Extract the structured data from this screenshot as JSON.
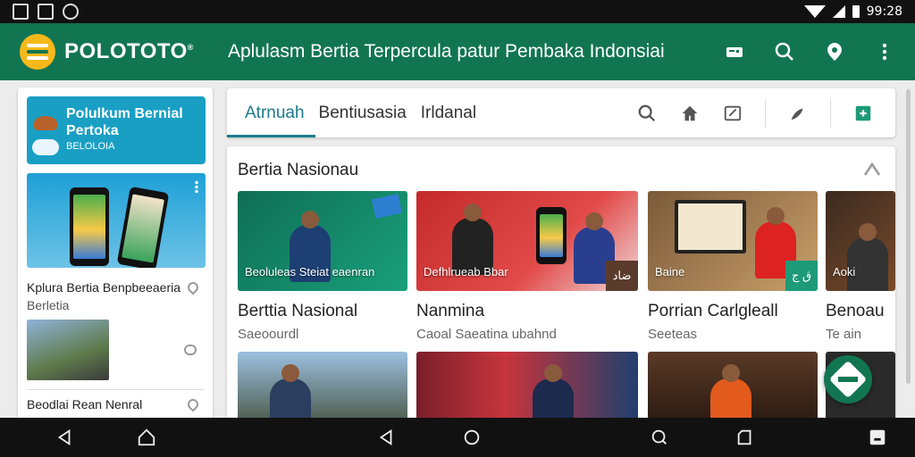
{
  "status": {
    "time": "99:28"
  },
  "appbar": {
    "brand": "POLOTOTO",
    "brand_mark": "®",
    "tagline": "Aplulasm Bertia Terpercula patur Pembaka Indonsiai",
    "actions": [
      "message-icon",
      "search-icon",
      "location-icon",
      "more-vert-icon"
    ]
  },
  "colors": {
    "primary": "#127552",
    "accent": "#1a7b8a",
    "promo": "#1a9fc4",
    "logo": "#f6b81a"
  },
  "sidebar": {
    "promo_title": "Polulkum Bernial Pertoka",
    "promo_sub": "BELOLOIA",
    "items": [
      {
        "title": "Kplura Bertia Benpbeeaeria",
        "sub": "Berletia"
      },
      {
        "title": "Beodlai Rean Nenral"
      }
    ]
  },
  "tabs": [
    {
      "label": "Atrnuah",
      "active": true
    },
    {
      "label": "Bentiusasia",
      "active": false
    },
    {
      "label": "Irldanal",
      "active": false
    }
  ],
  "tab_actions": [
    "search-icon",
    "home-icon",
    "edit-icon",
    "bookmark-icon",
    "share-icon"
  ],
  "section": {
    "title": "Bertia Nasionau",
    "cards": [
      {
        "caption": "Beoluleas Steiat eaenran",
        "title": "Berttia Nasional",
        "sub": "Saeoourdl",
        "badge": ""
      },
      {
        "caption": "Defhlrueab Bbar",
        "title": "Nanmina",
        "sub": "Caoal Saeatina ubahnd",
        "badge": "ضاد"
      },
      {
        "caption": "Baine",
        "title": "Porrian Carlgleall",
        "sub": "Seeteas",
        "badge": "ق ج"
      },
      {
        "caption": "Aoki",
        "title": "Benoau",
        "sub": "Te ain",
        "badge": ""
      }
    ]
  }
}
